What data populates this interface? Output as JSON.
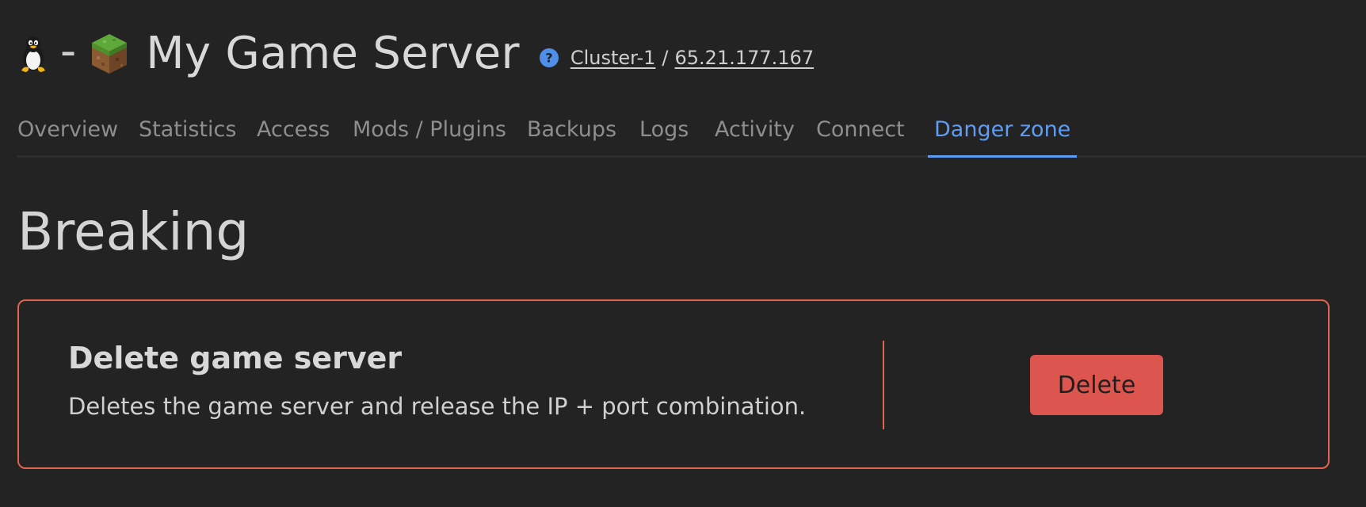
{
  "header": {
    "os_icon": "linux-tux-icon",
    "separator": "-",
    "game_icon": "minecraft-grass-block-icon",
    "title": "My Game Server",
    "help_icon": "question-circle-icon",
    "cluster": "Cluster-1",
    "slash": "/",
    "ip": "65.21.177.167"
  },
  "tabs": [
    {
      "label": "Overview",
      "active": false
    },
    {
      "label": "Statistics",
      "active": false
    },
    {
      "label": "Access",
      "active": false
    },
    {
      "label": "Mods / Plugins",
      "active": false
    },
    {
      "label": "Backups",
      "active": false
    },
    {
      "label": "Logs",
      "active": false
    },
    {
      "label": "Activity",
      "active": false
    },
    {
      "label": "Connect",
      "active": false
    },
    {
      "label": "Danger zone",
      "active": true
    }
  ],
  "section": {
    "title": "Breaking"
  },
  "danger_card": {
    "heading": "Delete game server",
    "description": "Deletes the game server and release the IP + port combination.",
    "button_label": "Delete"
  },
  "colors": {
    "background": "#232323",
    "accent": "#5f9cf4",
    "danger_border": "#e0644f",
    "danger_button": "#dc554e"
  }
}
